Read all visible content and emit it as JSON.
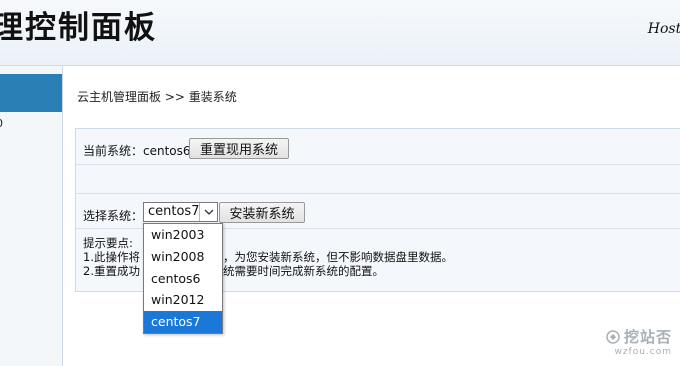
{
  "header": {
    "title": "理控制面板",
    "subtitle": "Host M"
  },
  "sidebar": {
    "partial_text": "0"
  },
  "breadcrumb": "云主机管理面板 >> 重装系统",
  "current_system": {
    "label": "当前系统：centos6",
    "reset_button": "重置现用系统"
  },
  "choose_system": {
    "label": "选择系统：",
    "selected": "centos7",
    "install_button": "安装新系统",
    "options": [
      "win2003",
      "win2008",
      "centos6",
      "win2012",
      "centos7"
    ]
  },
  "tips": {
    "heading": "提示要点:",
    "line1_start": "1.此操作将",
    "line1_end": "数据，为您安装新系统，但不影响数据盘里数据。",
    "line2_start": "2.重置成功",
    "line2_end": "，系统需要时间完成新系统的配置。"
  },
  "watermark": {
    "main": "挖站否",
    "sub": "wzfou.com"
  },
  "colors": {
    "accent": "#2a7fb5",
    "selected_option": "#1a78d8"
  }
}
